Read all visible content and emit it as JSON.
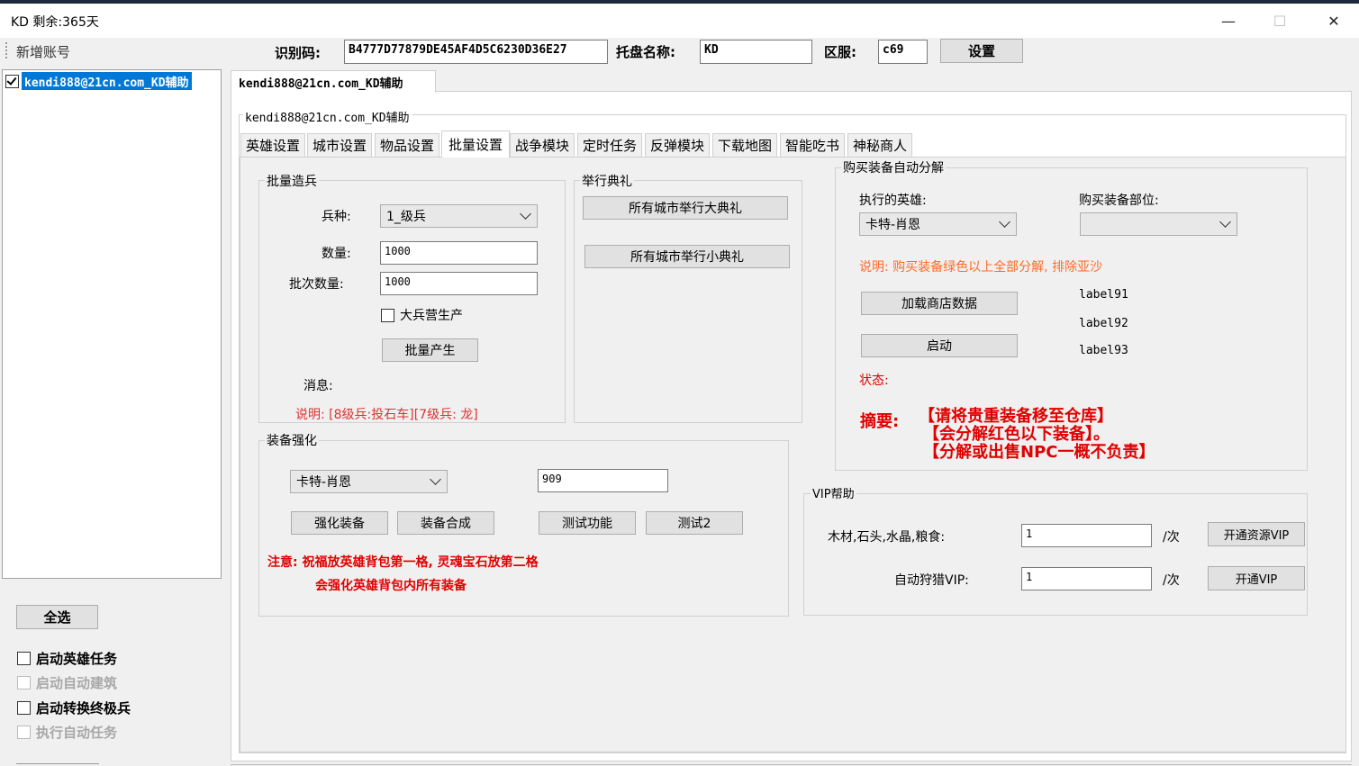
{
  "window": {
    "title": "KD 剩余:365天",
    "minimize": "—",
    "maximize": "☐",
    "close": "✕"
  },
  "toolbar": {
    "add_account": "新增账号",
    "id_label": "识别码:",
    "id_value": "B4777D77879DE45AF4D5C6230D36E27",
    "host_label": "托盘名称:",
    "host_value": "KD",
    "zone_label": "区服:",
    "zone_value": "c69",
    "set_button": "设置"
  },
  "accounts": [
    {
      "label": "kendi888@21cn.com_KD辅助",
      "checked": true
    }
  ],
  "left_panel": {
    "select_all": "全选",
    "options": [
      {
        "label": "启动英雄任务",
        "enabled": true
      },
      {
        "label": "启动自动建筑",
        "enabled": false
      },
      {
        "label": "启动转换终极兵",
        "enabled": true
      },
      {
        "label": "执行自动任务",
        "enabled": false
      }
    ]
  },
  "main": {
    "doc_tab": "kendi888@21cn.com_KD辅助",
    "group_title": "kendi888@21cn.com_KD辅助",
    "tabs": [
      "英雄设置",
      "城市设置",
      "物品设置",
      "批量设置",
      "战争模块",
      "定时任务",
      "反弹模块",
      "下载地图",
      "智能吃书",
      "神秘商人"
    ],
    "active_tab": "批量设置"
  },
  "batch_troops": {
    "title": "批量造兵",
    "type_label": "兵种:",
    "type_value": "1_级兵",
    "qty_label": "数量:",
    "qty_value": "1000",
    "batch_label": "批次数量:",
    "batch_value": "1000",
    "barracks_label": "大兵营生产",
    "produce_button": "批量产生",
    "message_label": "消息:",
    "note": "说明: [8级兵:投石车][7级兵: 龙]"
  },
  "ceremony": {
    "title": "举行典礼",
    "big_button": "所有城市举行大典礼",
    "small_button": "所有城市举行小典礼"
  },
  "equip_enhance": {
    "title": "装备强化",
    "hero_value": "卡特-肖恩",
    "number_value": "909",
    "enhance_button": "强化装备",
    "combine_button": "装备合成",
    "test_button": "测试功能",
    "test2_button": "测试2",
    "note_line1": "注意: 祝福放英雄背包第一格, 灵魂宝石放第二格",
    "note_line2": "会强化英雄背包内所有装备"
  },
  "auto_decompose": {
    "title": "购买装备自动分解",
    "hero_label": "执行的英雄:",
    "hero_value": "卡特-肖恩",
    "slot_label": "购买装备部位:",
    "slot_value": "",
    "note": "说明: 购买装备绿色以上全部分解, 排除亚沙",
    "load_button": "加载商店数据",
    "start_button": "启动",
    "label91": "label91",
    "label92": "label92",
    "label93": "label93",
    "status_label": "状态:",
    "summary_label": "摘要:",
    "summary_line1": "【请将贵重装备移至仓库】",
    "summary_line2": "【会分解红色以下装备】。",
    "summary_line3": "【分解或出售NPC一概不负责】"
  },
  "vip": {
    "title": "VIP帮助",
    "resources_label": "木材,石头,水晶,粮食:",
    "resources_value": "1",
    "per_time": "/次",
    "resources_button": "开通资源VIP",
    "hunt_label": "自动狩猎VIP:",
    "hunt_value": "1",
    "hunt_button": "开通VIP"
  },
  "colors": {
    "selection": "#0078d7",
    "warning": "#e00000",
    "note": "#ff6a2a"
  }
}
